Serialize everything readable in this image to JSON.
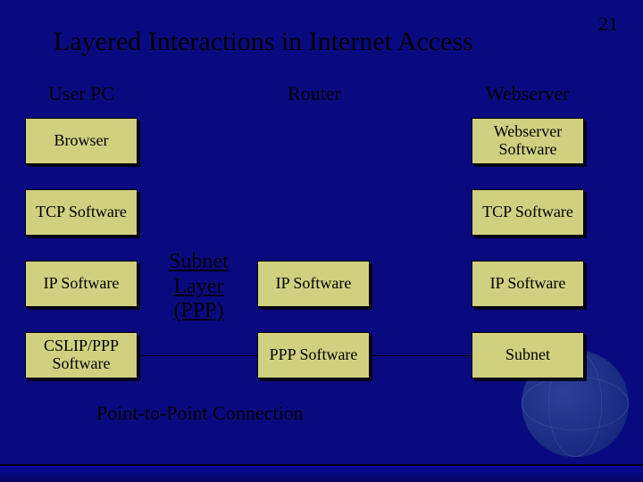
{
  "page_number": "21",
  "title": "Layered Interactions in Internet Access",
  "columns": {
    "user_pc": "User PC",
    "router": "Router",
    "webserver": "Webserver"
  },
  "boxes": {
    "browser": "Browser",
    "tcp_left": "TCP Software",
    "ip_left": "IP Software",
    "cslip_ppp": "CSLIP/PPP Software",
    "ip_mid": "IP Software",
    "ppp_mid": "PPP Software",
    "webserver_sw": "Webserver Software",
    "tcp_right": "TCP Software",
    "ip_right": "IP Software",
    "subnet": "Subnet"
  },
  "subnet_label": "Subnet Layer (PPP)",
  "footer": "Point-to-Point Connection"
}
